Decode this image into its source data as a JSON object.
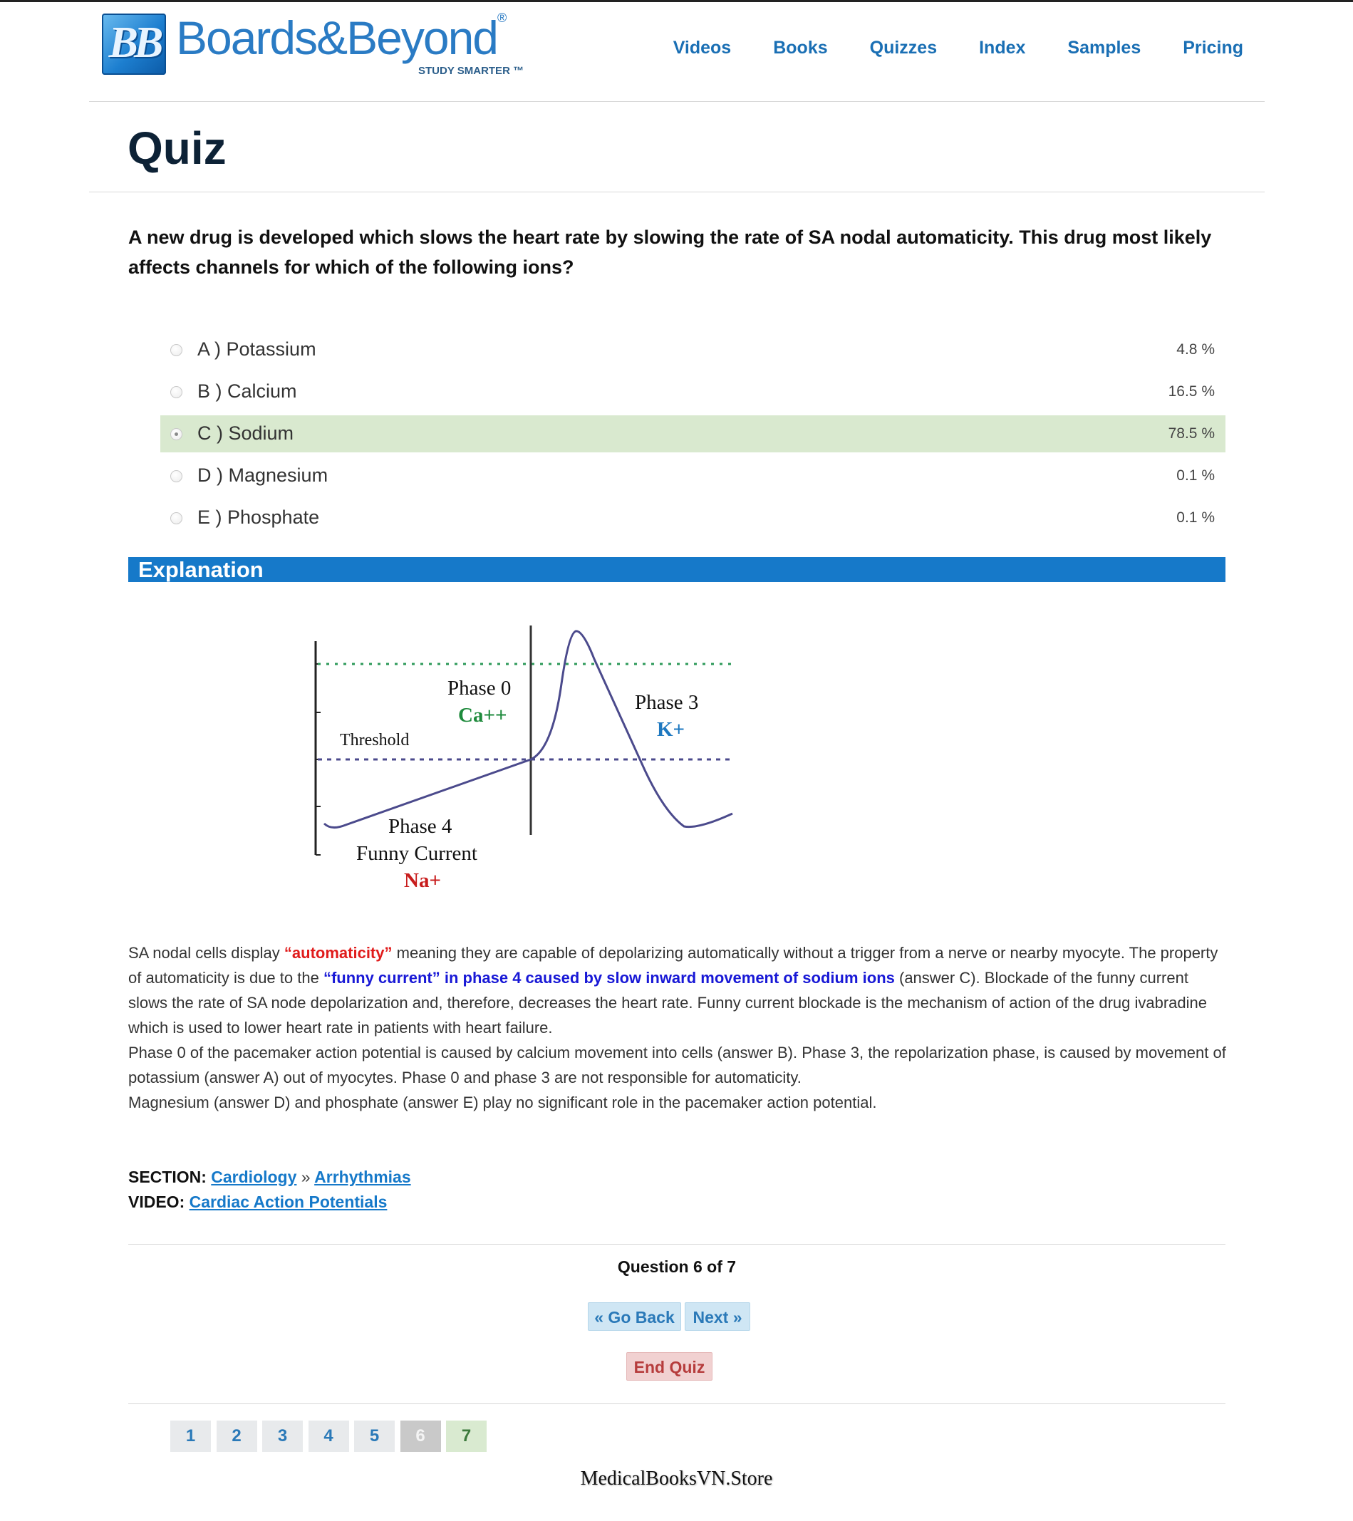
{
  "brand": {
    "logo_mark": "BB",
    "name": "Boards&Beyond",
    "registered": "®",
    "tagline": "STUDY SMARTER ™",
    "color": "#2a7bc4"
  },
  "nav": {
    "items": [
      {
        "label": "Videos"
      },
      {
        "label": "Books"
      },
      {
        "label": "Quizzes"
      },
      {
        "label": "Index"
      },
      {
        "label": "Samples"
      },
      {
        "label": "Pricing"
      }
    ]
  },
  "page": {
    "title": "Quiz"
  },
  "question": {
    "text": "A new drug is developed which slows the heart rate by slowing the rate of SA nodal automaticity. This drug most likely affects channels for which of the following ions?"
  },
  "options": [
    {
      "label": "A ) Potassium",
      "percent": "4.8 %",
      "selected": false
    },
    {
      "label": "B ) Calcium",
      "percent": "16.5 %",
      "selected": false
    },
    {
      "label": "C ) Sodium",
      "percent": "78.5 %",
      "selected": true
    },
    {
      "label": "D ) Magnesium",
      "percent": "0.1 %",
      "selected": false
    },
    {
      "label": "E ) Phosphate",
      "percent": "0.1 %",
      "selected": false
    }
  ],
  "explanation": {
    "heading": "Explanation",
    "diagram": {
      "phase0": "Phase 0",
      "phase0_ion": "Ca++",
      "phase3": "Phase 3",
      "phase3_ion": "K+",
      "threshold": "Threshold",
      "phase4": "Phase 4",
      "phase4_sub": "Funny Current",
      "phase4_ion": "Na+",
      "colors": {
        "ca": "#1e8a3c",
        "k": "#1e78c0",
        "na": "#c81d1d",
        "curve": "#4b4a8c"
      }
    },
    "p1_a": "SA nodal cells display ",
    "p1_red": "“automaticity”",
    "p1_b": " meaning they are capable of depolarizing automatically without a trigger from a nerve or nearby myocyte. The property of automaticity is due to the ",
    "p1_blue": "“funny current” in phase 4 caused by slow inward movement of sodium ions",
    "p1_c": " (answer C).  Blockade of the funny current slows the rate of SA node depolarization and, therefore, decreases the heart rate. Funny current blockade is the mechanism of action of the drug ivabradine which is used to lower heart rate in patients with heart failure.",
    "p2": "Phase 0 of the pacemaker action potential is caused by calcium movement into cells (answer B). Phase 3, the repolarization phase, is caused by movement of potassium (answer A) out of myocytes.  Phase 0 and phase 3 are not responsible for automaticity.",
    "p3": "Magnesium (answer D) and phosphate (answer E) play no significant role in the pacemaker action potential."
  },
  "section": {
    "label": "SECTION:",
    "link1": "Cardiology",
    "separator": "»",
    "link2": "Arrhythmias",
    "video_label": "VIDEO:",
    "video_link": "Cardiac Action Potentials"
  },
  "navigation": {
    "question_count": "Question 6 of 7",
    "back_label": "« Go Back",
    "next_label": "Next »",
    "end_label": "End Quiz"
  },
  "pager": {
    "pages": [
      "1",
      "2",
      "3",
      "4",
      "5",
      "6",
      "7"
    ],
    "current": "6"
  },
  "watermark": "MedicalBooksVN.Store"
}
